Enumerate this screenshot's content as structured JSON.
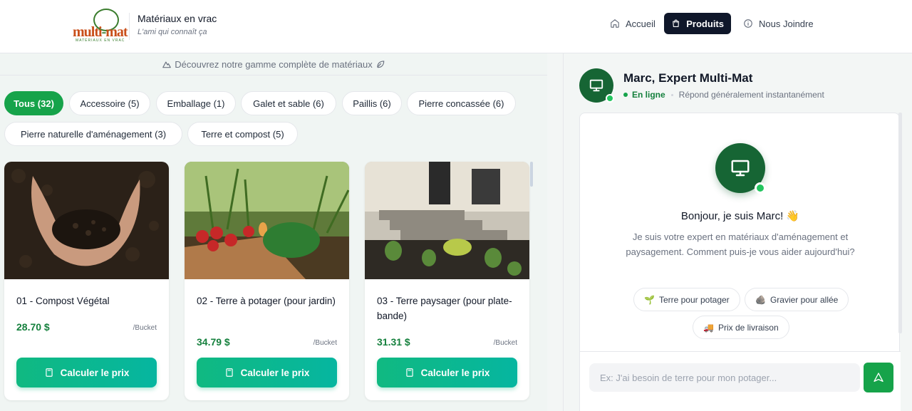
{
  "header": {
    "logo_text_1": "multi",
    "logo_text_2": "-",
    "logo_text_3": "mat",
    "logo_sub": "MATÉRIAUX EN VRAC",
    "brand_title": "Matériaux en vrac",
    "brand_tagline": "L'ami qui connaît ça",
    "nav": [
      {
        "label": "Accueil",
        "icon": "home-icon"
      },
      {
        "label": "Produits",
        "icon": "shopping-bag-icon",
        "active": true
      },
      {
        "label": "Nous Joindre",
        "icon": "info-icon"
      }
    ]
  },
  "catalog": {
    "discover_text": "Découvrez notre gamme complète de matériaux",
    "filters": [
      {
        "label": "Tous (32)",
        "active": true
      },
      {
        "label": "Accessoire (5)"
      },
      {
        "label": "Emballage (1)"
      },
      {
        "label": "Galet et sable (6)"
      },
      {
        "label": "Paillis (6)"
      },
      {
        "label": "Pierre concassée (6)"
      },
      {
        "label": "Pierre naturelle d'aménagement (3)"
      },
      {
        "label": "Terre et compost (5)"
      }
    ],
    "products": [
      {
        "name": "01 - Compost Végétal",
        "price": "28.70 $",
        "unit": "/Bucket",
        "button": "Calculer le prix"
      },
      {
        "name": "02 - Terre à potager (pour jardin)",
        "price": "34.79 $",
        "unit": "/Bucket",
        "button": "Calculer le prix"
      },
      {
        "name": "03 - Terre paysager (pour plate-bande)",
        "price": "31.31 $",
        "unit": "/Bucket",
        "button": "Calculer le prix"
      }
    ]
  },
  "chat": {
    "agent_name": "Marc, Expert Multi-Mat",
    "status": "En ligne",
    "response_time": "Répond généralement instantanément",
    "greeting": "Bonjour, je suis Marc! 👋",
    "intro": "Je suis votre expert en matériaux d'aménagement et paysagement. Comment puis-je vous aider aujourd'hui?",
    "suggestions": [
      {
        "emoji": "🌱",
        "label": "Terre pour potager"
      },
      {
        "emoji": "🪨",
        "label": "Gravier pour allée"
      },
      {
        "emoji": "🚚",
        "label": "Prix de livraison"
      }
    ],
    "input_placeholder": "Ex: J'ai besoin de terre pour mon potager..."
  },
  "colors": {
    "accent_green": "#16a34a",
    "dark_navy": "#0f172a",
    "price_green": "#15803d",
    "button_gradient_start": "#10b981",
    "button_gradient_end": "#06b6a0"
  }
}
